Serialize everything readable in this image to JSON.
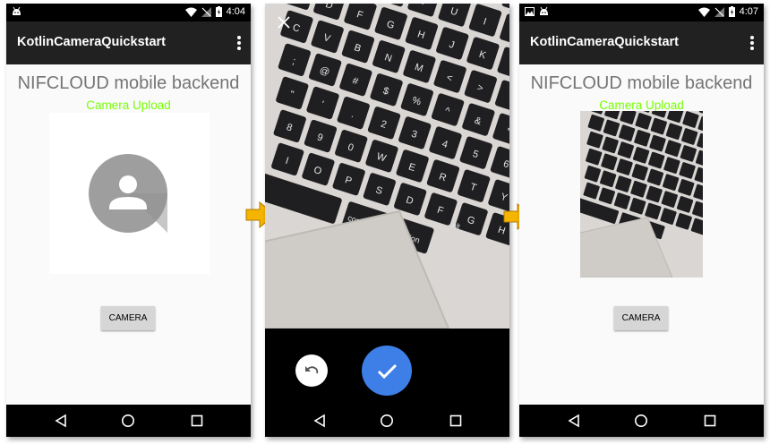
{
  "screens": [
    {
      "status_time": "4:04",
      "app_title": "KotlinCameraQuickstart",
      "heading": "NIFCLOUD mobile backend",
      "subheading": "Camera Upload",
      "camera_button": "CAMERA",
      "image_state": "placeholder-avatar"
    },
    {
      "photo_keys": [
        "command",
        "option",
        "alt"
      ],
      "photo_key_chars": [
        "2",
        "3",
        "4",
        "5",
        "6",
        "7",
        "8",
        "9",
        "0",
        "W",
        "E",
        "R",
        "T",
        "Y",
        "U",
        "I",
        "O",
        "P",
        "S",
        "D",
        "F",
        "G",
        "H",
        "J",
        "K",
        "L",
        "X",
        "C",
        "V",
        "B",
        "N",
        "M",
        "<",
        ">",
        "?",
        ":",
        ";",
        "@",
        "#",
        "$",
        "%",
        "^",
        "&",
        "*",
        "(",
        "\"",
        "'",
        "."
      ],
      "actions": [
        "close-icon",
        "retake-icon",
        "confirm-check-icon"
      ]
    },
    {
      "status_time": "4:07",
      "app_title": "KotlinCameraQuickstart",
      "heading": "NIFCLOUD mobile backend",
      "subheading": "Camera Upload",
      "camera_button": "CAMERA",
      "image_state": "captured-photo"
    }
  ],
  "colors": {
    "statusbar": "#000000",
    "appbar": "#212121",
    "heading": "#757575",
    "subheading": "#76ff03",
    "button": "#d6d6d6",
    "confirm": "#3d7fe6",
    "arrow": "#f5b400"
  }
}
